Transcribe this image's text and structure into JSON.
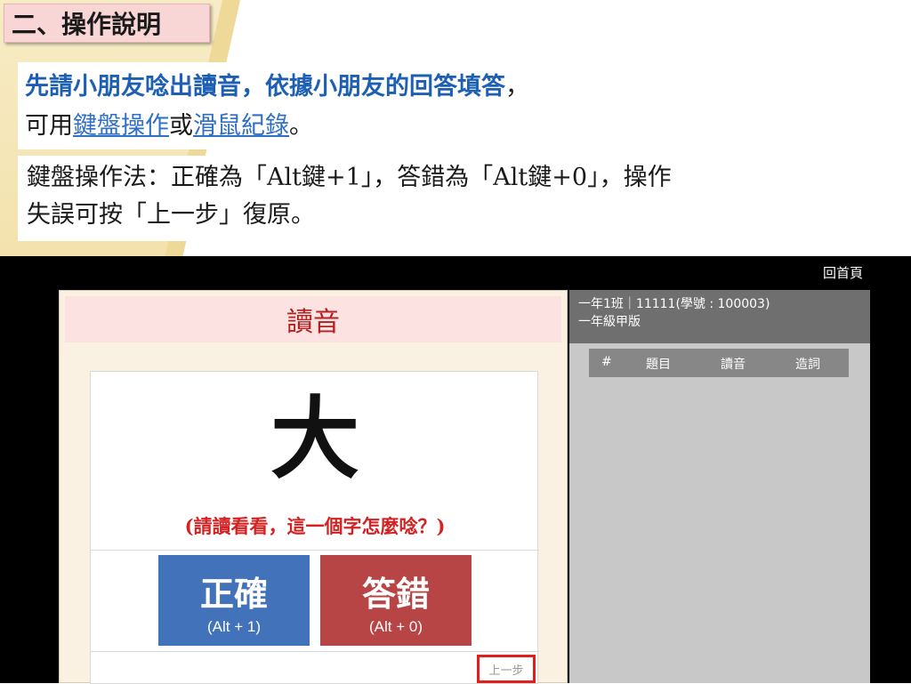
{
  "slide": {
    "title": "二、操作說明",
    "intro": {
      "line1_blue": "先請小朋友唸出讀音，依據小朋友的回答填答",
      "line1_tail": "，",
      "line2_prefix": "可用",
      "keyboard_link": "鍵盤操作",
      "line2_mid": "或",
      "mouse_link": "滑鼠紀錄",
      "line2_tail": "。"
    },
    "keys_instructions": {
      "line1": "鍵盤操作法：正確為「Alt鍵+1」，答錯為「Alt鍵+0」，操作",
      "line2": "失誤可按「上一步」復原。"
    }
  },
  "app": {
    "home_link": "回首頁",
    "panel_title": "讀音",
    "character": "大",
    "prompt": "(請讀看看，這一個字怎麼唸？)",
    "correct_button": {
      "label": "正確",
      "shortcut": "(Alt + 1)"
    },
    "wrong_button": {
      "label": "答錯",
      "shortcut": "(Alt + 0)"
    },
    "undo_button": "上一步",
    "student_info": {
      "line1": "一年1班｜11111(學號 : 100003)",
      "line2": "一年級甲版"
    },
    "table_columns": [
      "#",
      "題目",
      "讀音",
      "造詞"
    ]
  },
  "colors": {
    "correct": "#4272b9",
    "wrong": "#b84545",
    "highlight_frame": "#e01e1e",
    "prompt_text": "#d42222"
  }
}
